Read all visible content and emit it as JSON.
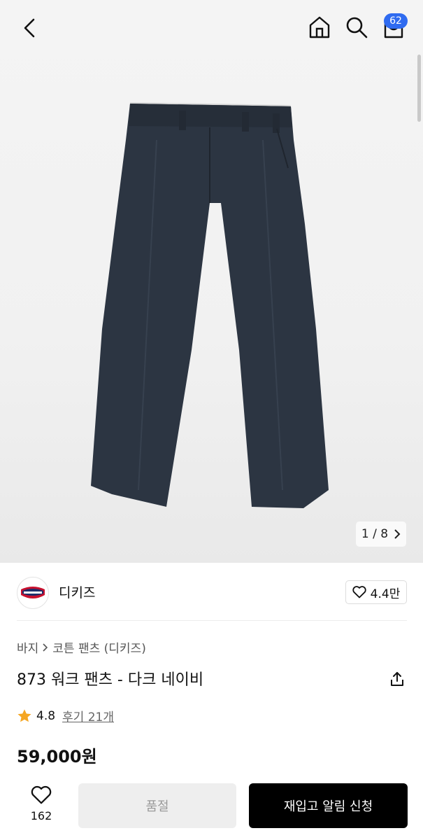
{
  "header": {
    "back_icon": "chevron-left-icon",
    "home_icon": "home-icon",
    "search_icon": "search-icon",
    "cart_icon": "cart-icon",
    "cart_count": "62",
    "badge_color": "#2f6bf0"
  },
  "gallery": {
    "current": "1",
    "separator": "/",
    "total": "8",
    "next_icon": "chevron-right-icon"
  },
  "brand": {
    "logo_text": "Dickies",
    "name": "디키즈",
    "like_icon": "heart-outline-icon",
    "like_count": "4.4만"
  },
  "product": {
    "breadcrumb": [
      "바지",
      "코튼 팬츠 (디키즈)"
    ],
    "title": "873 워크 팬츠 - 다크 네이비",
    "share_icon": "share-icon",
    "rating_icon": "star-icon",
    "rating": "4.8",
    "reviews_label": "후기 21개",
    "price": "59,000원"
  },
  "bottom_bar": {
    "wish_icon": "heart-outline-icon",
    "wish_count": "162",
    "option_label": "품절",
    "restock_label": "재입고 알림 신청"
  }
}
